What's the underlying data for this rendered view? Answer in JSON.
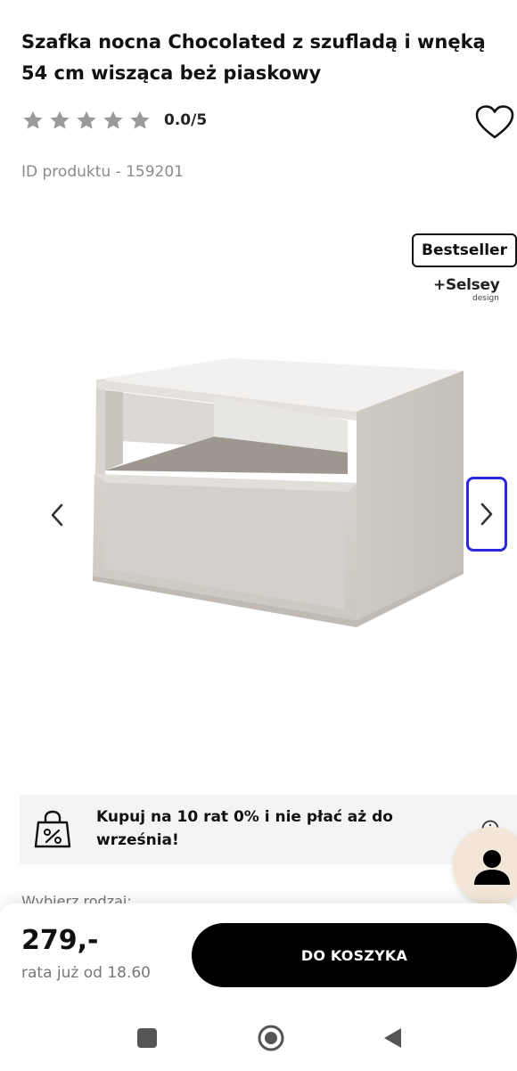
{
  "product": {
    "title": "Szafka nocna Chocolated z szufladą i wnęką 54 cm wisząca beż piaskowy",
    "rating": "0.0/5",
    "rating_stars": 0,
    "rating_max": 5,
    "id_text": "ID produktu - 159201"
  },
  "gallery": {
    "badge": "Bestseller",
    "brand": "+Selsey",
    "brand_sub": "design"
  },
  "promo": {
    "text": "Kupuj na 10 rat 0% i nie płać aż do września!"
  },
  "variant": {
    "label": "Wybierz rodzaj:"
  },
  "purchase": {
    "price": "279,-",
    "installment": "rata już od 18.60",
    "cart_button": "DO KOSZYKA"
  },
  "icons": {
    "wishlist": "heart-icon",
    "prev": "chevron-left-icon",
    "next": "chevron-right-icon",
    "promo": "shopping-bag-percent-icon",
    "chat": "person-icon"
  },
  "colors": {
    "accent_focus": "#2a2adc",
    "cart_button_bg": "#000000",
    "chat_bg": "#f3e6d8",
    "star_empty": "#9a9a9a"
  }
}
